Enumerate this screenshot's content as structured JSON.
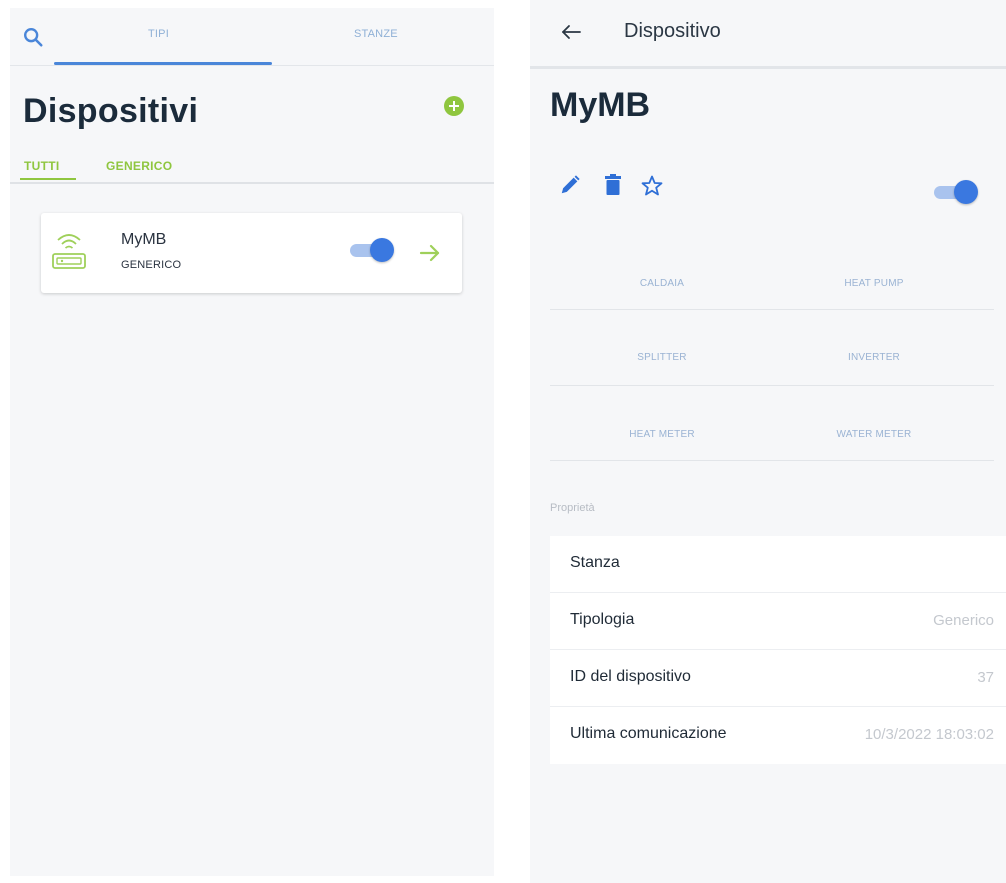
{
  "left_screen": {
    "tabs": [
      {
        "label": "TIPI",
        "active": true
      },
      {
        "label": "STANZE",
        "active": false
      }
    ],
    "title": "Dispositivi",
    "filters": [
      {
        "label": "TUTTI",
        "active": true
      },
      {
        "label": "GENERICO",
        "active": false
      }
    ],
    "device_card": {
      "name": "MyMB",
      "type": "GENERICO",
      "enabled": true
    },
    "icons": [
      "search-icon",
      "add-circle-icon",
      "router-icon",
      "arrow-right-icon"
    ]
  },
  "right_screen": {
    "app_title": "Dispositivo",
    "device_name": "MyMB",
    "enabled": true,
    "categories": [
      "CALDAIA",
      "HEAT PUMP",
      "SPLITTER",
      "INVERTER",
      "HEAT METER",
      "WATER METER"
    ],
    "properties_label": "Proprietà",
    "properties": [
      {
        "key": "Stanza",
        "value": ""
      },
      {
        "key": "Tipologia",
        "value": "Generico"
      },
      {
        "key": "ID del dispositivo",
        "value": "37"
      },
      {
        "key": "Ultima comunicazione",
        "value": "10/3/2022 18:03:02"
      }
    ],
    "icons": [
      "back-arrow-icon",
      "edit-icon",
      "trash-icon",
      "star-icon"
    ]
  },
  "colors": {
    "accent_green": "#8fc63f",
    "accent_blue": "#3a78e0",
    "tab_blue": "#4a86d9",
    "background": "#f6f7f9"
  }
}
